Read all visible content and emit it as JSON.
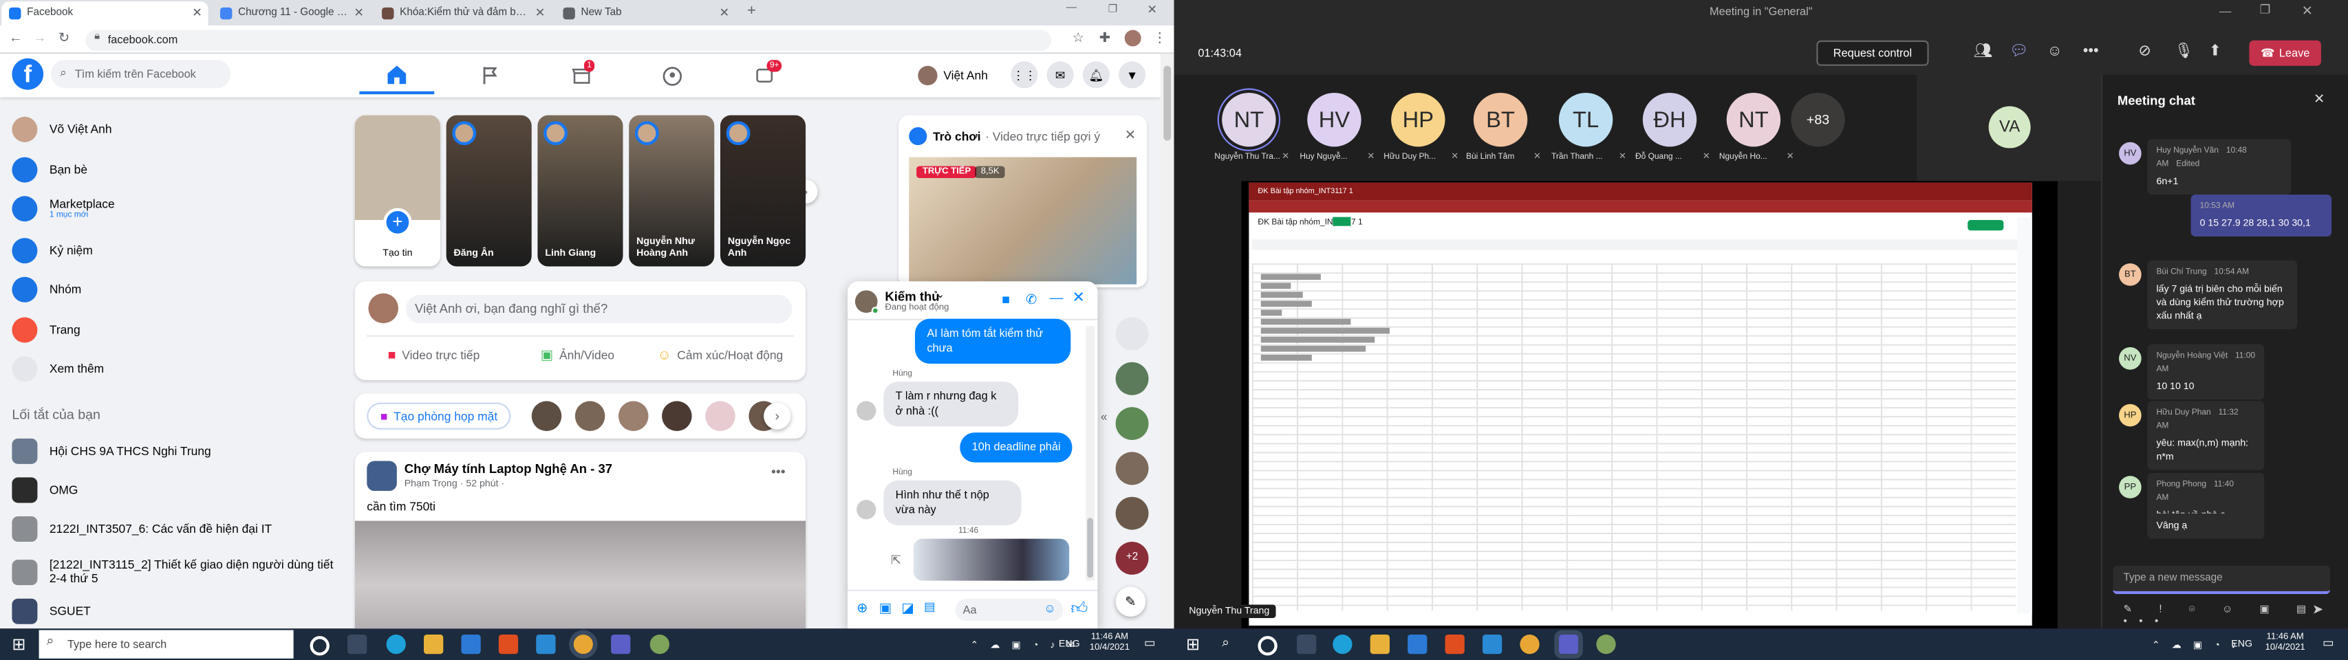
{
  "browser": {
    "tabs": [
      {
        "label": "Facebook",
        "color": "#1877f2",
        "active": true
      },
      {
        "label": "Chương 11 - Google Docs",
        "color": "#4285f4",
        "active": false
      },
      {
        "label": "Khóa:Kiểm thử và đảm bảo chấ",
        "color": "#6d4c41",
        "active": false
      },
      {
        "label": "New Tab",
        "color": "#5f6368",
        "active": false
      }
    ],
    "new_tab": "+",
    "url": "facebook.com"
  },
  "facebook": {
    "logo": "f",
    "search_placeholder": "Tìm kiếm trên Facebook",
    "nav_badges": {
      "marketplace": "1",
      "gaming": "9+"
    },
    "profile_name": "Việt Anh",
    "sidebar": [
      {
        "label": "Võ Việt Anh",
        "sub": "",
        "icon": "avatar",
        "color": "#c8a28a"
      },
      {
        "label": "Bạn bè",
        "sub": "",
        "icon": "friends-icon",
        "color": "#1b74e4"
      },
      {
        "label": "Marketplace",
        "sub": "1 mục mới",
        "icon": "marketplace-icon",
        "color": "#1b74e4"
      },
      {
        "label": "Kỷ niệm",
        "sub": "",
        "icon": "memories-icon",
        "color": "#1b74e4"
      },
      {
        "label": "Nhóm",
        "sub": "",
        "icon": "groups-icon",
        "color": "#1b74e4"
      },
      {
        "label": "Trang",
        "sub": "",
        "icon": "pages-icon",
        "color": "#f5533d"
      },
      {
        "label": "Xem thêm",
        "sub": "",
        "icon": "chevron-down-icon",
        "color": "#e4e6eb"
      }
    ],
    "shortcuts_title": "Lối tắt của bạn",
    "shortcuts": [
      {
        "label": "Hội CHS 9A THCS Nghi Trung",
        "color": "#6b7a8f"
      },
      {
        "label": "OMG",
        "color": "#2b2b2b"
      },
      {
        "label": "2122I_INT3507_6: Các vấn đề hiện đại IT",
        "color": "#8a8d91"
      },
      {
        "label": "[2122I_INT3115_2] Thiết kế giao diện người dùng tiết 2-4 thứ 5",
        "color": "#8a8d91"
      },
      {
        "label": "SGUET",
        "color": "#3a4a6b"
      }
    ],
    "stories": [
      {
        "name": "Tạo tin",
        "color": "#c7b9a8"
      },
      {
        "name": "Đăng Ân",
        "color": "#5a4a3e"
      },
      {
        "name": "Linh Giang",
        "color": "#7a6a58"
      },
      {
        "name": "Nguyễn Như Hoàng Anh",
        "color": "#8c7b6a"
      },
      {
        "name": "Nguyễn Ngọc Anh",
        "color": "#3a2e28"
      }
    ],
    "composer_placeholder": "Việt Anh ơi, bạn đang nghĩ gì thế?",
    "composer_actions": [
      "Video trực tiếp",
      "Ảnh/Video",
      "Cảm xúc/Hoạt động"
    ],
    "room_button": "Tạo phòng họp mặt",
    "post": {
      "author": "Chợ Máy tính Laptop Nghệ An - 37",
      "byline": "Phạm Trọng · 52 phút ·",
      "text": "cần tìm 750ti"
    },
    "game_card": {
      "label": "Trò chơi",
      "sub": "· Video trực tiếp gợi ý",
      "live": "TRỰC TIẾP",
      "views": "8,5K"
    },
    "chat": {
      "name": "Kiếm thủ",
      "status": "Đang hoạt động",
      "messages": [
        {
          "from": "me",
          "sender": "",
          "text": "AI làm tóm tắt kiểm thử chưa"
        },
        {
          "from": "them",
          "sender": "Hùng",
          "text": "T làm r nhưng đag k ở nhà :(("
        },
        {
          "from": "me",
          "sender": "",
          "text": "10h deadline phải"
        },
        {
          "from": "them",
          "sender": "Hùng",
          "text": "Hình như thế t nộp vừa này"
        }
      ],
      "time_label": "11:46",
      "input_placeholder": "Aa",
      "extra_heads": "+2"
    }
  },
  "teams": {
    "title": "Meeting in \"General\"",
    "timer": "01:43:04",
    "request_control": "Request control",
    "leave": "Leave",
    "participants": [
      {
        "initials": "NT",
        "name": "Nguyễn Thu Tra...",
        "color": "#e1d5e9"
      },
      {
        "initials": "HV",
        "name": "Huy Nguyễ...",
        "color": "#ddd0f0"
      },
      {
        "initials": "HP",
        "name": "Hữu Duy Ph...",
        "color": "#f8d48a"
      },
      {
        "initials": "BT",
        "name": "Bùi Linh Tâm",
        "color": "#f2c3a0"
      },
      {
        "initials": "TL",
        "name": "Trần Thanh ...",
        "color": "#bfe0f2"
      },
      {
        "initials": "ĐH",
        "name": "Đỗ Quang ...",
        "color": "#d3d0e9"
      },
      {
        "initials": "NT",
        "name": "Nguyễn Ho...",
        "color": "#ead0d8"
      }
    ],
    "more_count": "+83",
    "self_initials": "VA",
    "presenter": "Nguyễn Thu Trang",
    "shared_doc_title": "ĐK Bài tập nhóm_INT3117 1",
    "chat": {
      "title": "Meeting chat",
      "messages": [
        {
          "side": "left",
          "initials": "HV",
          "color": "#c9bde8",
          "name": "Huy Nguyễn Văn",
          "time": "10:48 AM",
          "edited": "Edited",
          "text": "6n+1"
        },
        {
          "side": "right",
          "initials": "",
          "color": "",
          "name": "",
          "time": "10:53 AM",
          "edited": "",
          "text": "0 15 27.9 28 28,1 30 30,1"
        },
        {
          "side": "left",
          "initials": "BT",
          "color": "#f2c3a0",
          "name": "Bùi Chí Trung",
          "time": "10:54 AM",
          "edited": "",
          "text": "lấy 7 giá trị biên cho mỗi biến và dùng kiểm thử trường hợp xấu nhất ạ"
        },
        {
          "side": "left",
          "initials": "NV",
          "color": "#c6e5c0",
          "name": "Nguyễn Hoàng Việt",
          "time": "11:00 AM",
          "edited": "",
          "text": "10 10 10"
        },
        {
          "side": "left",
          "initials": "HP",
          "color": "#f8d48a",
          "name": "Hữu Duy Phan",
          "time": "11:32 AM",
          "edited": "",
          "text": "yêu: max(n,m) mạnh: n*m"
        },
        {
          "side": "left",
          "initials": "PP",
          "color": "#c6e5c0",
          "name": "Phong Phong",
          "time": "11:40 AM",
          "edited": "",
          "text": "bài tập về nhà ạ"
        },
        {
          "side": "left",
          "initials": "",
          "color": "",
          "name": "",
          "time": "",
          "edited": "",
          "text": "Vâng ạ"
        }
      ],
      "input_placeholder": "Type a new message"
    }
  },
  "taskbar_left": {
    "search_placeholder": "Type here to search",
    "time": "11:46 AM",
    "date": "10/4/2021",
    "lang": "ENG"
  },
  "taskbar_right": {
    "time": "11:46 AM",
    "date": "10/4/2021",
    "lang": "ENG"
  }
}
